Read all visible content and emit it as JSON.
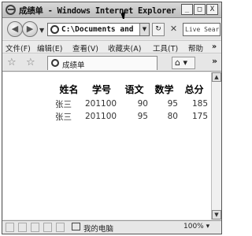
{
  "window": {
    "title": "成绩单 - Windows Internet Explorer",
    "controls": [
      "_",
      "□",
      "X"
    ]
  },
  "address_bar": {
    "back_label": "◀",
    "forward_label": "▶",
    "url": "C:\\Documents and S",
    "search_placeholder": "Live Search"
  },
  "menu": {
    "items": [
      "文件(F)",
      "编辑(E)",
      "查看(V)",
      "收藏夹(A)",
      "工具(T)",
      "帮助"
    ]
  },
  "tabs": {
    "active_label": "成绩单"
  },
  "table": {
    "headers": [
      "姓名",
      "学号",
      "语文",
      "数学",
      "总分"
    ],
    "rows": [
      [
        "张三",
        "201100",
        "90",
        "95",
        "185"
      ],
      [
        "张三",
        "201100",
        "95",
        "80",
        "175"
      ]
    ]
  },
  "status": {
    "zone_text": "我的电脑",
    "zoom": "100%"
  }
}
